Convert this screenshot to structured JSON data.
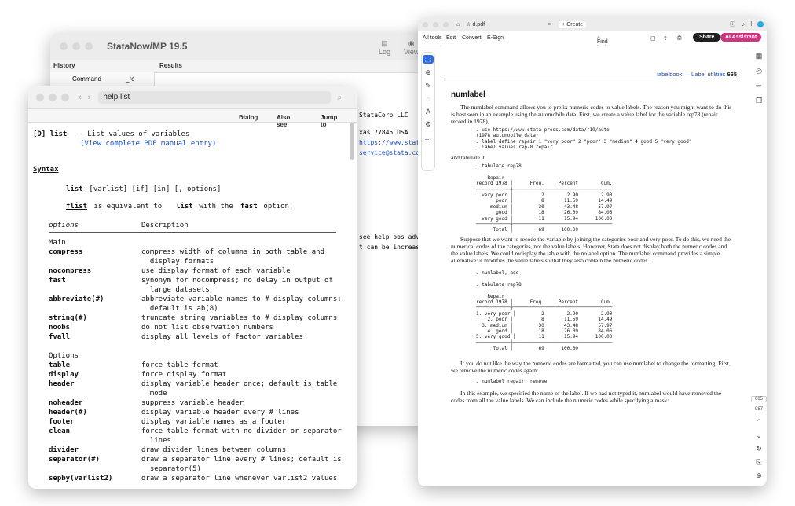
{
  "stata": {
    "title": "StataNow/MP 19.5",
    "toolbar": [
      "Log",
      "View"
    ],
    "history_header": "History",
    "results_header": "Results",
    "history_cols": [
      "Command",
      "_rc"
    ],
    "results_lines": [
      "StataCorp LLC",
      "xas 77845 USA",
      "https://www.stat",
      "service@stata.co",
      "see help obs_adv",
      "t can be increas"
    ]
  },
  "help": {
    "title": "help list",
    "menus": [
      "Dialog",
      "Also see",
      "Jump to"
    ],
    "header_prefix": "[D] list",
    "header_rest": " — List values of variables",
    "view_pdf": "(View complete PDF manual entry)",
    "syntax_heading": "Syntax",
    "syntax_cmd": "list",
    "syntax_args": " [varlist] [if] [in] [, options]",
    "flist_cmd": "flist",
    "flist_mid": " is equivalent to ",
    "flist_list": "list",
    "flist_with": " with the ",
    "flist_fast": "fast",
    "flist_end": " option.",
    "col_options": "options",
    "col_desc": "Description",
    "main_label": "Main",
    "options_label": "Options",
    "rows": [
      {
        "opt": "compress",
        "d": [
          "compress width of columns in both table and",
          "  display formats"
        ]
      },
      {
        "opt": "nocompress",
        "d": [
          "use display format of each variable"
        ]
      },
      {
        "opt": "fast",
        "d": [
          "synonym for nocompress; no delay in output of",
          "  large datasets"
        ]
      },
      {
        "opt": "abbreviate(#)",
        "d": [
          "abbreviate variable names to # display columns;",
          "  default is ab(8)"
        ]
      },
      {
        "opt": "string(#)",
        "d": [
          "truncate string variables to # display columns"
        ]
      },
      {
        "opt": "noobs",
        "d": [
          "do not list observation numbers"
        ]
      },
      {
        "opt": "fvall",
        "d": [
          "display all levels of factor variables"
        ]
      }
    ],
    "rows2": [
      {
        "opt": "table",
        "d": [
          "force table format"
        ]
      },
      {
        "opt": "display",
        "d": [
          "force display format"
        ]
      },
      {
        "opt": "header",
        "d": [
          "display variable header once; default is table",
          "  mode"
        ]
      },
      {
        "opt": "noheader",
        "d": [
          "suppress variable header"
        ]
      },
      {
        "opt": "header(#)",
        "d": [
          "display variable header every # lines"
        ]
      },
      {
        "opt": "footer",
        "d": [
          "display variable names as a footer"
        ]
      },
      {
        "opt": "clean",
        "d": [
          "force table format with no divider or separator",
          "  lines"
        ]
      },
      {
        "opt": "divider",
        "d": [
          "draw divider lines between columns"
        ]
      },
      {
        "opt": "separator(#)",
        "d": [
          "draw a separator line every # lines; default is",
          "  separator(5)"
        ]
      },
      {
        "opt": "sepby(varlist2)",
        "d": [
          "draw a separator line whenever varlist2 values"
        ]
      }
    ]
  },
  "pdf": {
    "tab_title": "d.pdf",
    "new_tab": "Create",
    "toolbar": [
      "All tools",
      "Edit",
      "Convert",
      "E-Sign"
    ],
    "find": "Find text or tools",
    "share": "Share",
    "assistant": "AI Assistant",
    "running_head": "labelbook — Label utilities",
    "page_num": "665",
    "heading": "numlabel",
    "p1": "The numlabel command allows you to prefix numeric codes to value labels. The reason you might want to do this is best seen in an example using the automobile data. First, we create a value label for the variable rep78 (repair record in 1978),",
    "code1": [
      ". use https://www.stata-press.com/data/r19/auto",
      "(1978 automobile data)",
      ". label define repair 1 \"very poor\" 2 \"poor\" 3 \"medium\" 4 good 5 \"very good\"",
      ". label values rep78 repair"
    ],
    "and_tab": "and tabulate it.",
    "tab1": [
      ". tabulate rep78",
      "",
      "    Repair",
      "record 1978 │      Freq.     Percent        Cum.",
      "────────────┼───────────────────────────────────",
      "  very poor │          2        2.90        2.90",
      "       poor │          8       11.59       14.49",
      "     medium │         30       43.48       57.97",
      "       good │         18       26.09       84.06",
      "  very good │         11       15.94      100.00",
      "────────────┼───────────────────────────────────",
      "      Total │         69      100.00"
    ],
    "p2": "Suppose that we want to recode the variable by joining the categories poor and very poor. To do this, we need the numerical codes of the categories, not the value labels. However, Stata does not display both the numeric codes and the value labels. We could redisplay the table with the nolabel option. The numlabel command provides a simple alternative: it modifies the value labels so that they also contain the numeric codes.",
    "tab2": [
      ". numlabel, add",
      "",
      ". tabulate rep78",
      "",
      "    Repair",
      "record 1978 │      Freq.     Percent        Cum.",
      "────────────┼───────────────────────────────────",
      "1. very poor │         2        2.90        2.90",
      "    2. poor │          8       11.59       14.49",
      "  3. medium │         30       43.48       57.97",
      "    4. good │         18       26.09       84.06",
      "5. very good │        11       15.94      100.00",
      "────────────┼───────────────────────────────────",
      "      Total │         69      100.00"
    ],
    "p3": "If you do not like the way the numeric codes are formatted, you can use numlabel to change the formatting. First, we remove the numeric codes again:",
    "code3": ". numlabel repair, remove",
    "p4": "In this example, we specified the name of the label. If we had not typed it, numlabel would have removed the codes from all the value labels. We can include the numeric codes while specifying a mask:",
    "page_box": "665",
    "page_total": "987"
  },
  "colors": {
    "accent": "#1a4fc0",
    "share_btn": "#1f1f1f",
    "assistant_btn": "#d0367d"
  }
}
